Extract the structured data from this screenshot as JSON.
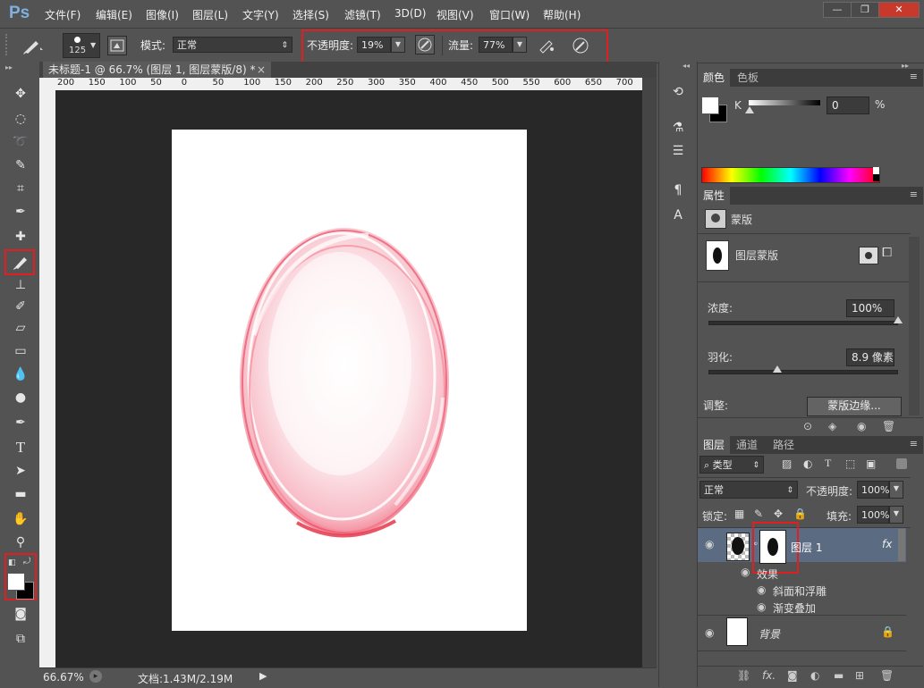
{
  "app": {
    "logo": "Ps"
  },
  "menu": [
    "文件(F)",
    "编辑(E)",
    "图像(I)",
    "图层(L)",
    "文字(Y)",
    "选择(S)",
    "滤镜(T)",
    "3D(D)",
    "视图(V)",
    "窗口(W)",
    "帮助(H)"
  ],
  "window_controls": {
    "minimize": "—",
    "restore": "❐",
    "close": "✕"
  },
  "options": {
    "brush_size": "125",
    "mode_label": "模式:",
    "mode_value": "正常",
    "opacity_label": "不透明度:",
    "opacity_value": "19%",
    "flow_label": "流量:",
    "flow_value": "77%"
  },
  "document": {
    "tab_title": "未标题-1 @ 66.7% (图层 1, 图层蒙版/8) *",
    "tab_close": "×",
    "ruler_ticks": [
      "200",
      "150",
      "100",
      "50",
      "0",
      "50",
      "100",
      "150",
      "200",
      "250",
      "300",
      "350",
      "400",
      "450",
      "500",
      "550",
      "600",
      "650",
      "700",
      "750"
    ]
  },
  "status": {
    "zoom": "66.67%",
    "doc_info": "文档:1.43M/2.19M"
  },
  "color_panel": {
    "tabs": [
      "颜色",
      "色板"
    ],
    "channel_label": "K",
    "value": "0",
    "unit": "%"
  },
  "properties_panel": {
    "tab": "属性",
    "header": "蒙版",
    "mask_label": "图层蒙版",
    "density_label": "浓度:",
    "density_value": "100%",
    "density": 1.0,
    "feather_label": "羽化:",
    "feather_value": "8.9 像素",
    "refine_label": "调整:",
    "refine_button": "蒙版边缘..."
  },
  "layers_panel": {
    "tabs": [
      "图层",
      "通道",
      "路径"
    ],
    "filter_type": "类型",
    "blend_mode": "正常",
    "opacity_label": "不透明度:",
    "opacity_value": "100%",
    "lock_label": "锁定:",
    "fill_label": "填充:",
    "fill_value": "100%",
    "layers": [
      {
        "name": "图层 1",
        "fx": "fx",
        "effects_label": "效果",
        "effects": [
          "斜面和浮雕",
          "渐变叠加"
        ]
      },
      {
        "name": "背景"
      }
    ]
  },
  "colors": {
    "accent_red": "#e02020",
    "selected_layer": "#5a6b82",
    "panel": "#535353",
    "canvas": "#282828"
  }
}
